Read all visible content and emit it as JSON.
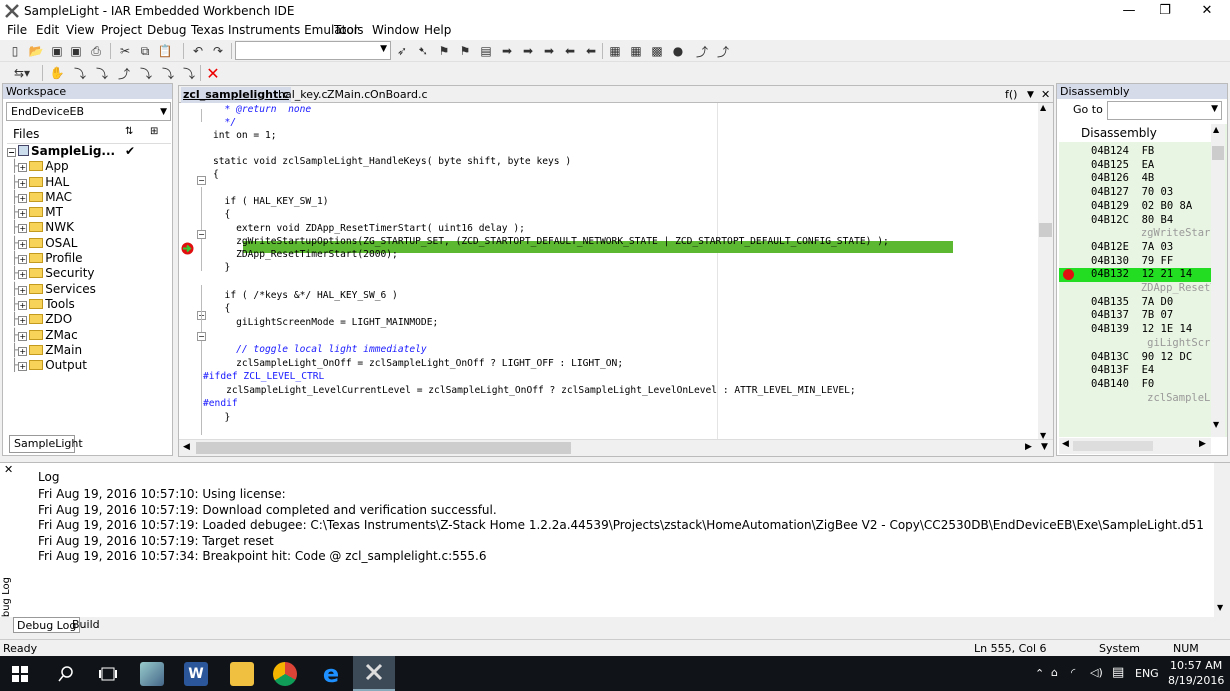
{
  "window": {
    "title": "SampleLight - IAR Embedded Workbench IDE",
    "buttons": [
      "—",
      "❐",
      "✕"
    ]
  },
  "menu": [
    "File",
    "Edit",
    "View",
    "Project",
    "Debug",
    "Texas Instruments Emulator",
    "Tools",
    "Window",
    "Help"
  ],
  "toolbar": {
    "combo_value": ""
  },
  "workspace": {
    "header": "Workspace",
    "config": "EndDeviceEB",
    "files_label": "Files",
    "project": "SampleLig...",
    "project_check": "✔",
    "folders": [
      "App",
      "HAL",
      "MAC",
      "MT",
      "NWK",
      "OSAL",
      "Profile",
      "Security",
      "Services",
      "Tools",
      "ZDO",
      "ZMac",
      "ZMain",
      "Output"
    ],
    "bottom_tab": "SampleLight"
  },
  "editor": {
    "tabs": [
      "zcl_samplelight.c",
      "hal_key.c",
      "ZMain.c",
      "OnBoard.c"
    ],
    "func_indicator": "f()",
    "lines": [
      "  * @return  none",
      "  */",
      "int on = 1;",
      "",
      "static void zclSampleLight_HandleKeys( byte shift, byte keys )",
      "{",
      "",
      "  if ( HAL_KEY_SW_1)",
      "  {",
      "    extern void ZDApp_ResetTimerStart( uint16 delay );",
      "    zgWriteStartupOptions(ZG_STARTUP_SET, (ZCD_STARTOPT_DEFAULT_NETWORK_STATE | ZCD_STARTOPT_DEFAULT_CONFIG_STATE) );",
      "    ZDApp_ResetTimerStart(2000);",
      "  }",
      "",
      "  if ( /*keys &*/ HAL_KEY_SW_6 )",
      "  {",
      "    giLightScreenMode = LIGHT_MAINMODE;",
      "",
      "    // toggle local light immediately",
      "    zclSampleLight_OnOff = zclSampleLight_OnOff ? LIGHT_OFF : LIGHT_ON;",
      "#ifdef ZCL_LEVEL_CTRL",
      "    zclSampleLight_LevelCurrentLevel = zclSampleLight_OnOff ? zclSampleLight_LevelOnLevel : ATTR_LEVEL_MIN_LEVEL;",
      "#endif",
      "  }"
    ]
  },
  "disassembly": {
    "header": "Disassembly",
    "goto_label": "Go to",
    "panel_title": "Disassembly",
    "rows": [
      {
        "addr": "04B124",
        "bytes": "FB"
      },
      {
        "addr": "04B125",
        "bytes": "EA"
      },
      {
        "addr": "04B126",
        "bytes": "4B"
      },
      {
        "addr": "04B127",
        "bytes": "70 03"
      },
      {
        "addr": "04B129",
        "bytes": "02 B0 8A"
      },
      {
        "addr": "04B12C",
        "bytes": "80 B4"
      },
      {
        "src": "zgWriteStartu"
      },
      {
        "addr": "04B12E",
        "bytes": "7A 03"
      },
      {
        "addr": "04B130",
        "bytes": "79 FF"
      },
      {
        "addr": "04B132",
        "bytes": "12 21 14"
      },
      {
        "src": "ZDApp_ResetTi"
      },
      {
        "addr": "04B135",
        "bytes": "7A D0"
      },
      {
        "addr": "04B137",
        "bytes": "7B 07"
      },
      {
        "addr": "04B139",
        "bytes": "12 1E 14"
      },
      {
        "src": "giLightScree"
      },
      {
        "addr": "04B13C",
        "bytes": "90 12 DC"
      },
      {
        "addr": "04B13F",
        "bytes": "E4"
      },
      {
        "addr": "04B140",
        "bytes": "F0"
      },
      {
        "src": "zclSampleLig"
      }
    ]
  },
  "log": {
    "title": "Log",
    "side_label": "Debug Log",
    "lines": [
      "Fri Aug 19, 2016 10:57:10: Using license:",
      "Fri Aug 19, 2016 10:57:19: Download completed and verification successful.",
      "Fri Aug 19, 2016 10:57:19: Loaded debugee: C:\\Texas Instruments\\Z-Stack Home 1.2.2a.44539\\Projects\\zstack\\HomeAutomation\\ZigBee V2 - Copy\\CC2530DB\\EndDeviceEB\\Exe\\SampleLight.d51",
      "Fri Aug 19, 2016 10:57:19: Target reset",
      "Fri Aug 19, 2016 10:57:34: Breakpoint hit: Code @ zcl_samplelight.c:555.6"
    ],
    "tabs": [
      "Debug Log",
      "Build"
    ]
  },
  "status": {
    "left": "Ready",
    "position": "Ln 555, Col 6",
    "mode": "System",
    "numlock": "NUM"
  },
  "taskbar": {
    "lang": "ENG",
    "time": "10:57 AM",
    "date": "8/19/2016"
  },
  "colors": {
    "highlight": "#5cb830",
    "breakpoint": "#e01010",
    "dis_current": "#22dd22"
  }
}
